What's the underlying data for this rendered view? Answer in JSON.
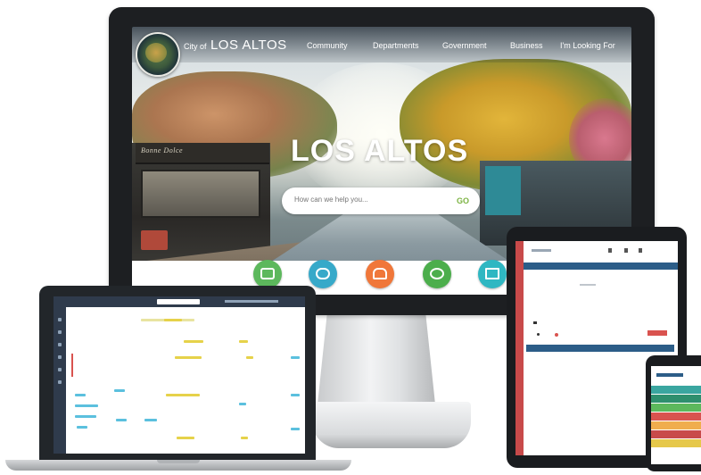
{
  "website": {
    "title_prefix": "City of",
    "title": "LOS ALTOS",
    "nav": [
      "Community",
      "Departments",
      "Government",
      "Business",
      "I'm Looking For"
    ],
    "hero_title": "LOS ALTOS",
    "search_placeholder": "How can we help you...",
    "search_button": "GO",
    "storefront_sign": "Bonne Dolce",
    "quick_links": [
      {
        "color": "#5cb85c",
        "icon": "calendar-icon"
      },
      {
        "color": "#37a9c9",
        "icon": "chat-icon"
      },
      {
        "color": "#f0773a",
        "icon": "bell-icon"
      },
      {
        "color": "#4cae4c",
        "icon": "bike-icon"
      },
      {
        "color": "#2fb7c2",
        "icon": "building-icon"
      }
    ]
  },
  "colors": {
    "laptop_nav": "#2f3b4c",
    "tablet_accent": "#c84a4a",
    "tablet_header": "#2c5d88"
  }
}
